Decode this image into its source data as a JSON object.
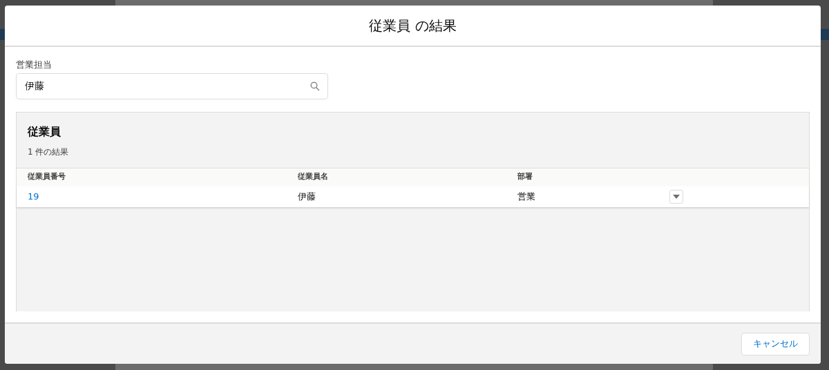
{
  "modal": {
    "title": "従業員 の結果"
  },
  "search": {
    "label": "営業担当",
    "value": "伊藤"
  },
  "results": {
    "title": "従業員",
    "count": "1 件の結果",
    "columns": [
      "従業員番号",
      "従業員名",
      "部署"
    ],
    "rows": [
      {
        "cells": [
          "19",
          "伊藤",
          "営業"
        ]
      }
    ]
  },
  "buttons": [
    "キャンセル"
  ]
}
